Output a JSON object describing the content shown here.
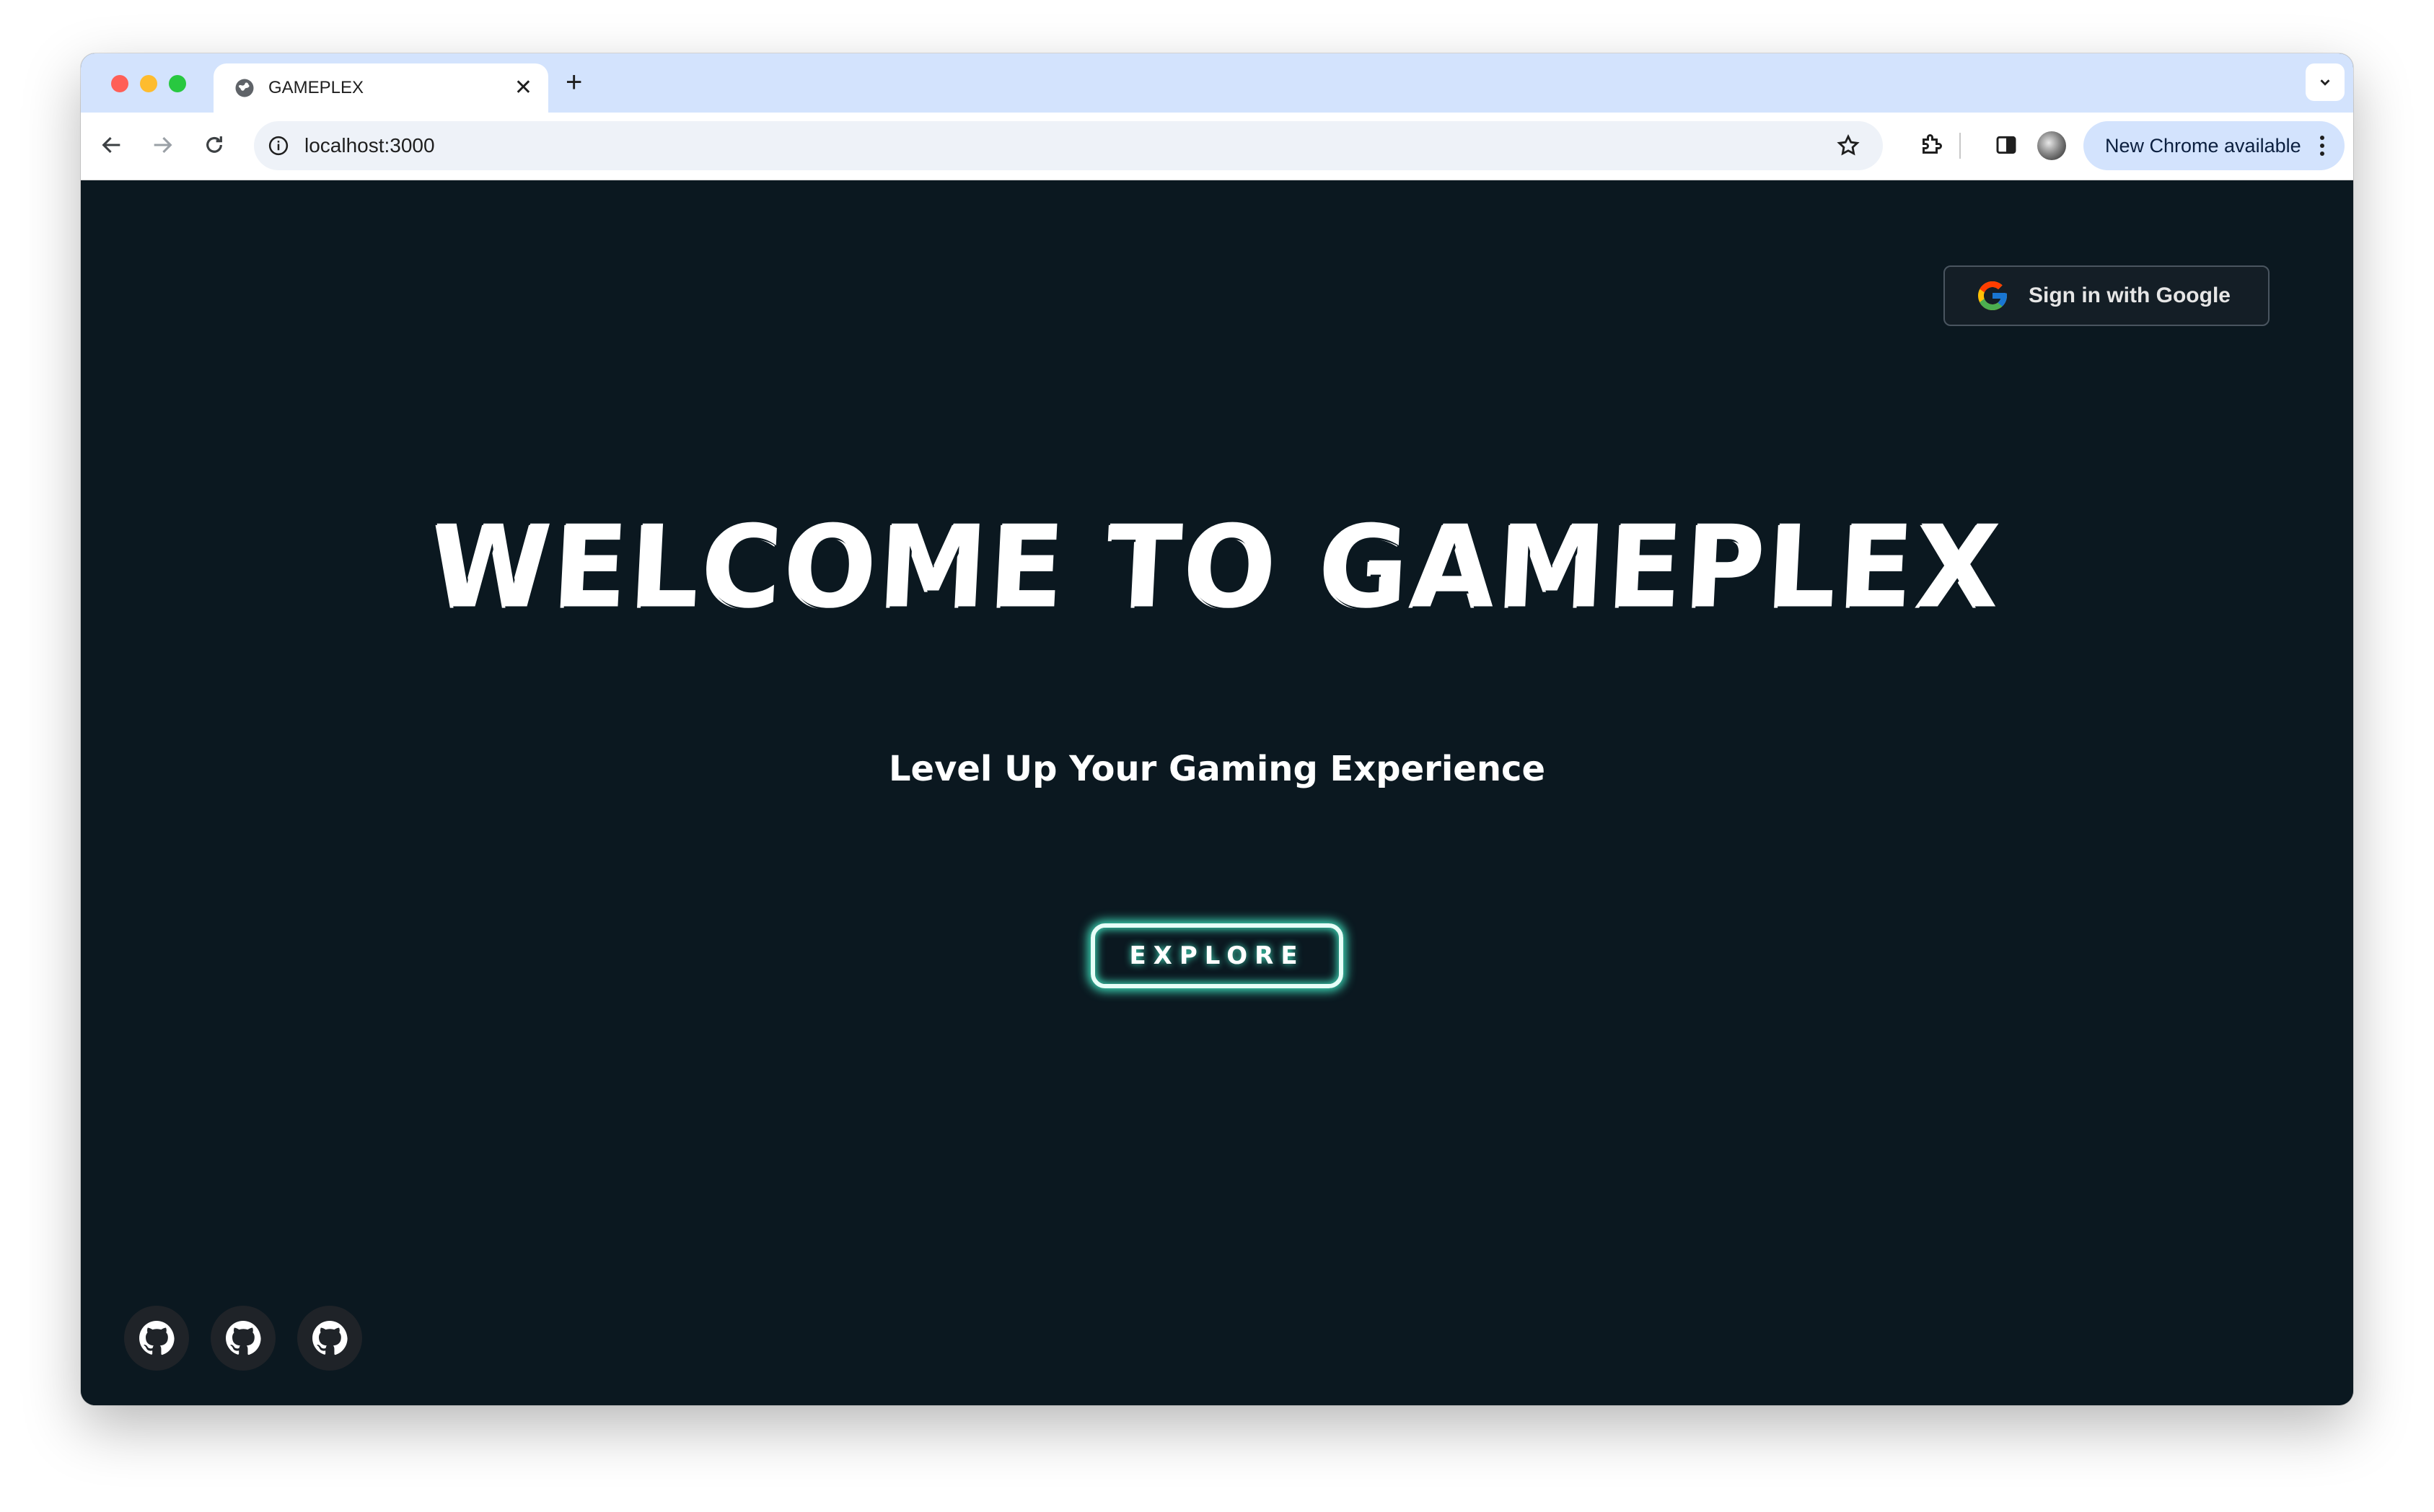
{
  "browser": {
    "tab_title": "GAMEPLEX",
    "url": "localhost:3000",
    "update_label": "New Chrome available"
  },
  "page": {
    "sign_in_label": "Sign in with Google",
    "hero_title": "WELCOME TO GAMEPLEX",
    "hero_subtitle": "Level Up Your Gaming Experience",
    "explore_label": "EXPLORE",
    "social_links": [
      "github-icon",
      "github-icon",
      "github-icon"
    ]
  },
  "colors": {
    "page_bg": "#0b1820",
    "neon_accent": "#3fe0bd",
    "tabstrip_bg": "#d3e3fd"
  }
}
